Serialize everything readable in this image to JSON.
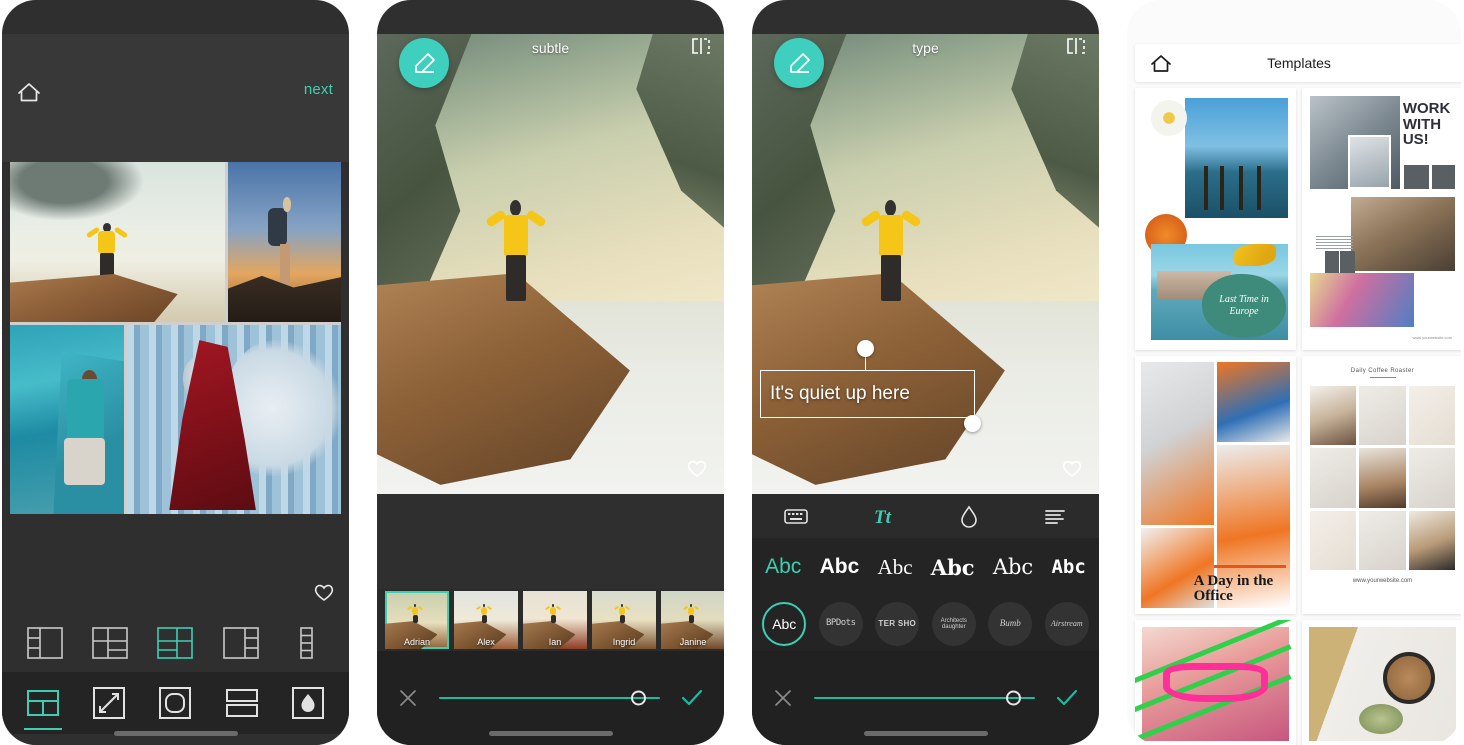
{
  "phone1": {
    "name": "collage-editor",
    "topbar": {
      "home_icon": "home-icon",
      "next_label": "next"
    },
    "favorite_icon": "heart-icon",
    "layout_options": [
      {
        "id": "layout-1",
        "label": "2-left-stack",
        "selected": false
      },
      {
        "id": "layout-2",
        "label": "quad-mix",
        "selected": false
      },
      {
        "id": "layout-3",
        "label": "three-up",
        "selected": true
      },
      {
        "id": "layout-4",
        "label": "left-big-right-stack",
        "selected": false
      },
      {
        "id": "layout-5",
        "label": "vertical-strip",
        "selected": false
      }
    ],
    "tools": [
      {
        "id": "tool-grid",
        "label": "grid",
        "selected": true
      },
      {
        "id": "tool-resize",
        "label": "resize",
        "selected": false
      },
      {
        "id": "tool-rounded",
        "label": "rounded-corners",
        "selected": false
      },
      {
        "id": "tool-spacing",
        "label": "spacing",
        "selected": false
      },
      {
        "id": "tool-background",
        "label": "background",
        "selected": false
      }
    ],
    "cells": [
      {
        "id": "cell-cliff",
        "alt": "man-on-cliff"
      },
      {
        "id": "cell-hiker",
        "alt": "hiker-at-sunset"
      },
      {
        "id": "cell-lake",
        "alt": "man-overlooking-lake"
      },
      {
        "id": "cell-wolf",
        "alt": "red-cloak-and-wolf"
      }
    ]
  },
  "phone2": {
    "name": "filter-editor",
    "title": "subtle",
    "eraser_icon": "eraser-icon",
    "compare_icon": "compare-split-icon",
    "favorite_icon": "heart-icon",
    "filters": [
      {
        "name": "Adrian",
        "selected": true
      },
      {
        "name": "Alex",
        "selected": false
      },
      {
        "name": "Ian",
        "selected": false
      },
      {
        "name": "Ingrid",
        "selected": false
      },
      {
        "name": "Janine",
        "selected": false
      }
    ],
    "bottom": {
      "cancel_icon": "close-x-icon",
      "confirm_icon": "check-icon",
      "slider_value": 100
    }
  },
  "phone3": {
    "name": "text-editor",
    "title": "type",
    "eraser_icon": "eraser-icon",
    "compare_icon": "compare-split-icon",
    "favorite_icon": "heart-icon",
    "overlay_text": "It's quiet up here",
    "tabs": [
      {
        "id": "tab-keyboard",
        "icon": "keyboard-icon",
        "selected": false
      },
      {
        "id": "tab-typeface",
        "icon": "typeface-tt-icon",
        "selected": true
      },
      {
        "id": "tab-color",
        "icon": "droplet-icon",
        "selected": false
      },
      {
        "id": "tab-align",
        "icon": "align-left-icon",
        "selected": false
      }
    ],
    "font_samples": [
      {
        "label": "Abc",
        "style": "sans",
        "selected": true
      },
      {
        "label": "Abc",
        "style": "bold",
        "selected": false
      },
      {
        "label": "Abc",
        "style": "serif",
        "selected": false
      },
      {
        "label": "Abc",
        "style": "slab",
        "selected": false
      },
      {
        "label": "Abc",
        "style": "thin",
        "selected": false
      },
      {
        "label": "Abc",
        "style": "mono",
        "selected": false
      }
    ],
    "font_chips": [
      {
        "label": "Abc",
        "selected": true
      },
      {
        "label": "BPDots",
        "selected": false
      },
      {
        "label": "TER SHO",
        "selected": false
      },
      {
        "label": "Architects daughter",
        "selected": false
      },
      {
        "label": "Bumb",
        "selected": false
      },
      {
        "label": "Airstream",
        "selected": false
      }
    ],
    "bottom": {
      "cancel_icon": "close-x-icon",
      "confirm_icon": "check-icon",
      "slider_value": 100
    }
  },
  "phone4": {
    "name": "templates-browser",
    "home_icon": "home-icon",
    "title": "Templates",
    "templates": [
      {
        "id": "template-europe",
        "caption": "Last Time in Europe"
      },
      {
        "id": "template-work",
        "heading": "WORK WITH US!",
        "url": "www.yourwebsite.com"
      },
      {
        "id": "template-office",
        "caption": "A Day in the Office"
      },
      {
        "id": "template-coffee",
        "heading": "Daily Coffee Roaster",
        "url": "www.yourwebsite.com"
      },
      {
        "id": "template-glasses",
        "caption": ""
      },
      {
        "id": "template-latte",
        "caption": ""
      }
    ]
  },
  "colors": {
    "accent_teal": "#3ecfb2",
    "slider_teal": "#19bca0",
    "dark_bg": "#2f2f2f",
    "darker_bg": "#242424",
    "topbar_bg": "#383838"
  }
}
